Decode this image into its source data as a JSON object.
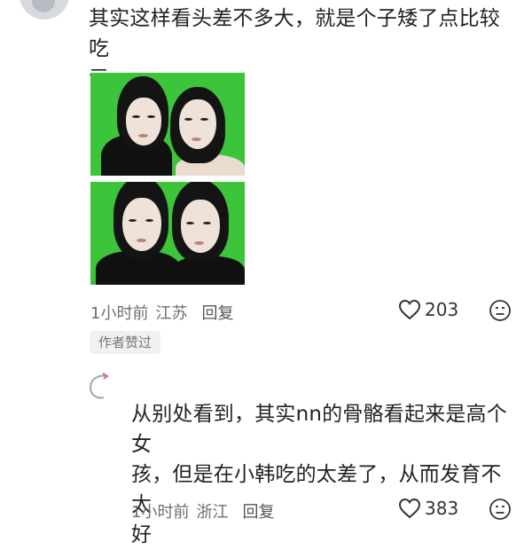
{
  "comments": [
    {
      "text": "其实这样看头差不多大，就是个子矮了点比较吃\n亏",
      "time": "1小时前",
      "location": "江苏",
      "reply_label": "回复",
      "likes": "203",
      "author_badge": "作者赞过",
      "image_count": 2
    },
    {
      "text": "从别处看到，其实nn的骨骼看起来是高个女\n孩，但是在小韩吃的太差了，从而发育不太\n好",
      "time": "1小时前",
      "location": "浙江",
      "reply_label": "回复",
      "likes": "383"
    }
  ],
  "colors": {
    "photo_background": "#3cc43a",
    "meta_text": "#6f6f6f",
    "badge_background": "#f1f1f1"
  },
  "icons": {
    "like": "heart-outline-icon",
    "emoji": "meh-face-icon"
  }
}
